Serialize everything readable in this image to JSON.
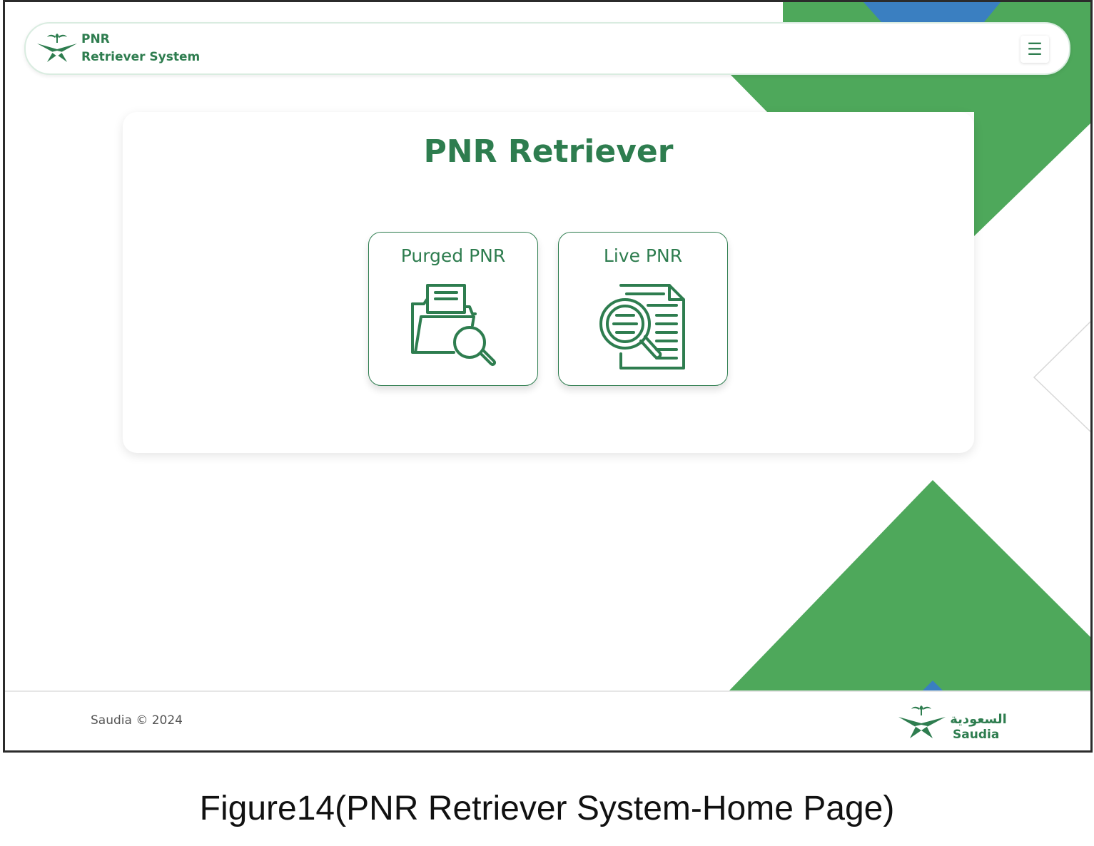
{
  "navbar": {
    "brand_line1": "PNR",
    "brand_line2": "Retriever System",
    "menu_icon": "hamburger-menu-icon"
  },
  "main": {
    "title": "PNR Retriever",
    "tiles": [
      {
        "label": "Purged PNR",
        "icon": "folder-search-icon"
      },
      {
        "label": "Live PNR",
        "icon": "document-search-icon"
      }
    ]
  },
  "footer": {
    "copyright": "Saudia © 2024",
    "logo_arabic": "السعودية",
    "logo_latin": "Saudia"
  },
  "caption": "Figure14(PNR Retriever System-Home Page)",
  "colors": {
    "brand_green": "#2e7d4f",
    "shape_green": "#4ea85b",
    "shape_blue": "#3a7fc1"
  }
}
